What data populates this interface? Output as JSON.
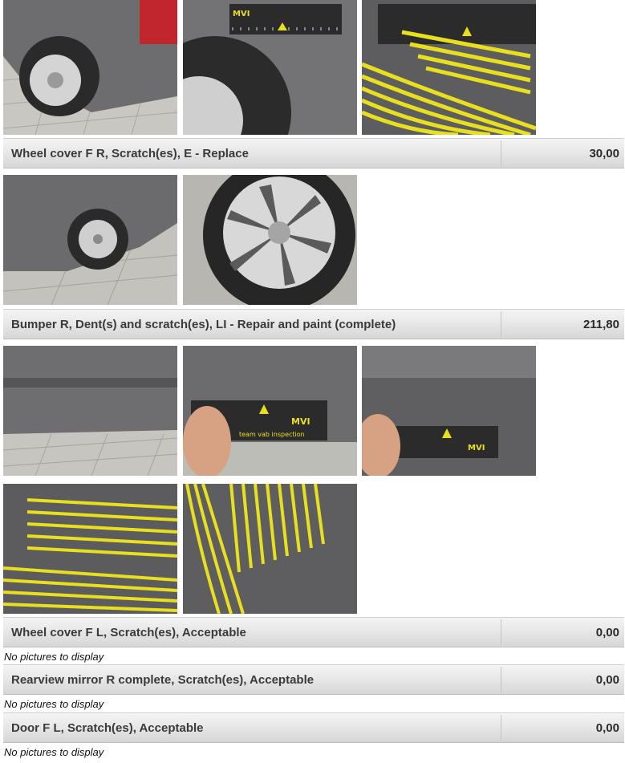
{
  "damages": [
    {
      "title": "Wheel cover F R, Scratch(es), E - Replace",
      "amount": "30,00"
    },
    {
      "title": "Bumper R, Dent(s) and scratch(es), LI - Repair and paint (complete)",
      "amount": "211,80"
    },
    {
      "title": "Wheel cover F L, Scratch(es), Acceptable",
      "amount": "0,00",
      "note": "No pictures to display"
    },
    {
      "title": "Rearview mirror R complete, Scratch(es), Acceptable",
      "amount": "0,00",
      "note": "No pictures to display"
    },
    {
      "title": "Door F L, Scratch(es), Acceptable",
      "amount": "0,00",
      "note": "No pictures to display"
    }
  ],
  "ruler_brand": "MVI",
  "ruler_text": "team vab inspection",
  "colors": {
    "car": "#6f6f70",
    "pavement": "#bdbdb8",
    "strip_yellow": "#e8e01e",
    "ruler": "#2b2b2b"
  }
}
